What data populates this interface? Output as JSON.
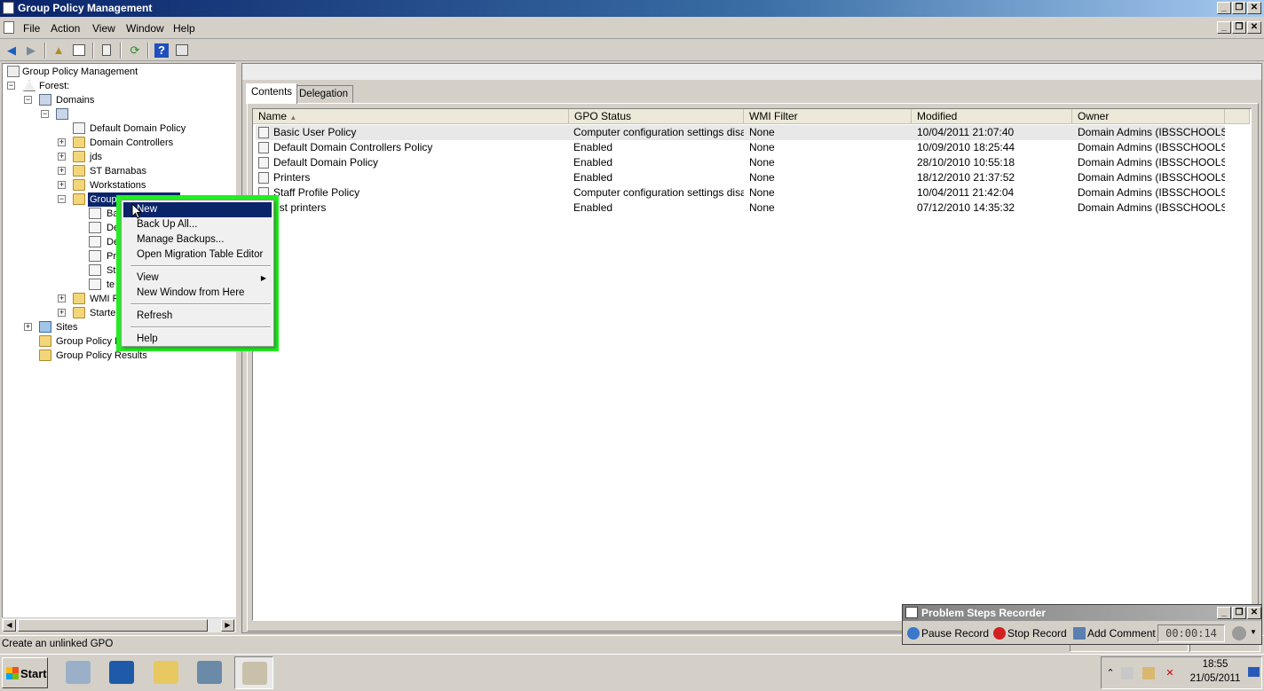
{
  "window": {
    "title": "Group Policy Management",
    "controls": [
      "_",
      "❐",
      "✕"
    ]
  },
  "menu": {
    "items": [
      "File",
      "Action",
      "View",
      "Window",
      "Help"
    ]
  },
  "tree": {
    "root": "Group Policy Management",
    "forest": "Forest:",
    "domains": "Domains",
    "default_domain_policy": "Default Domain Policy",
    "domain_controllers": "Domain Controllers",
    "jds": "jds",
    "st_barnabas": "ST Barnabas",
    "workstations": "Workstations",
    "gpo_container": "Group",
    "gpo_children": [
      "Ba",
      "De",
      "De",
      "Pr",
      "St",
      "te"
    ],
    "wmi": "WMI F",
    "starter": "Starte",
    "sites": "Sites",
    "gp_modeling": "Group Policy M",
    "gp_results": "Group Policy Results"
  },
  "tabs": [
    "Contents",
    "Delegation"
  ],
  "table": {
    "columns": [
      "Name",
      "GPO Status",
      "WMI Filter",
      "Modified",
      "Owner"
    ],
    "rows": [
      [
        "Basic User Policy",
        "Computer configuration settings disab...",
        "None",
        "10/04/2011 21:07:40",
        "Domain Admins (IBSSCHOOLS..."
      ],
      [
        "Default Domain Controllers Policy",
        "Enabled",
        "None",
        "10/09/2010 18:25:44",
        "Domain Admins (IBSSCHOOLS..."
      ],
      [
        "Default Domain Policy",
        "Enabled",
        "None",
        "28/10/2010 10:55:18",
        "Domain Admins (IBSSCHOOLS..."
      ],
      [
        "Printers",
        "Enabled",
        "None",
        "18/12/2010 21:37:52",
        "Domain Admins (IBSSCHOOLS..."
      ],
      [
        "Staff Profile Policy",
        "Computer configuration settings disab...",
        "None",
        "10/04/2011 21:42:04",
        "Domain Admins (IBSSCHOOLS..."
      ],
      [
        "est printers",
        "Enabled",
        "None",
        "07/12/2010 14:35:32",
        "Domain Admins (IBSSCHOOLS..."
      ]
    ]
  },
  "context_menu": {
    "items": [
      "New",
      "Back Up All...",
      "Manage Backups...",
      "Open Migration Table Editor",
      "View",
      "New Window from Here",
      "Refresh",
      "Help"
    ]
  },
  "status": {
    "text": "Create an unlinked GPO"
  },
  "psr": {
    "title": "Problem Steps Recorder",
    "pause": "Pause Record",
    "stop": "Stop Record",
    "comment": "Add Comment",
    "timer": "00:00:14"
  },
  "taskbar": {
    "start": "Start",
    "time": "18:55",
    "date": "21/05/2011"
  },
  "colors": {
    "highlight": "#0a246a",
    "callout_border": "#22ee22"
  }
}
